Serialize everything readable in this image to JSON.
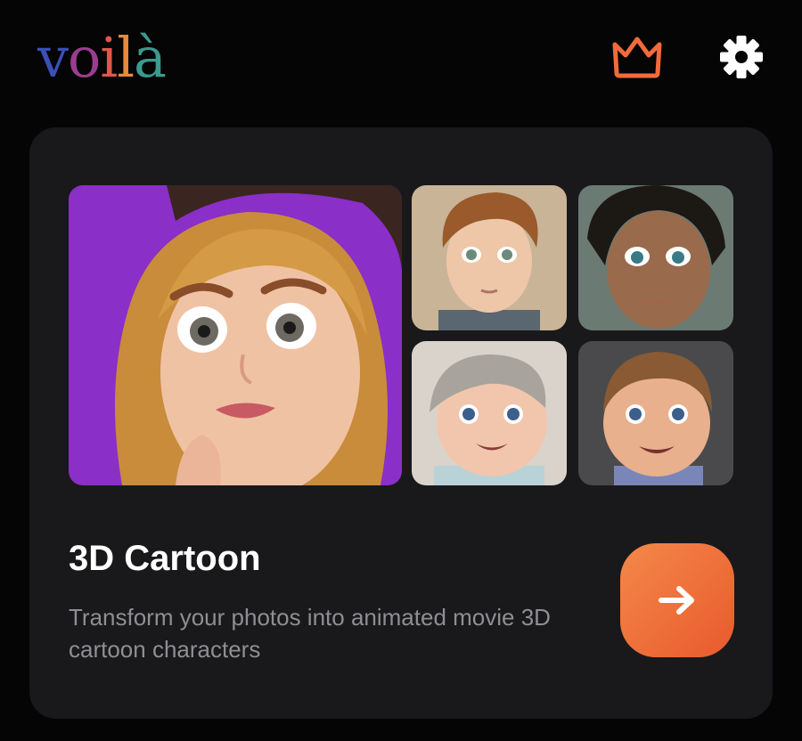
{
  "app": {
    "logo_letters": [
      {
        "char": "v",
        "color": "#3b4fb8"
      },
      {
        "char": "o",
        "color": "#9a3d8f"
      },
      {
        "char": "i",
        "color": "#e0574a"
      },
      {
        "char": "l",
        "color": "#e88a3a"
      },
      {
        "char": "à",
        "color": "#3a9b8e"
      }
    ]
  },
  "header": {
    "crown_icon": "crown-icon",
    "crown_color": "#f26b3a",
    "settings_icon": "gear-icon",
    "settings_color": "#ffffff"
  },
  "feature_card": {
    "title": "3D Cartoon",
    "description": "Transform your photos into animated movie 3D cartoon characters",
    "button_icon": "arrow-right-icon",
    "accent_color": "#ef6f3a",
    "preview_images": [
      {
        "name": "cartoon-woman-portrait",
        "background": "#8a2fc7"
      },
      {
        "name": "cartoon-boy-portrait",
        "background": "#c9b497"
      },
      {
        "name": "cartoon-girl-portrait",
        "background": "#6b7a72"
      },
      {
        "name": "cartoon-baby-portrait",
        "background": "#d9d3cc"
      },
      {
        "name": "cartoon-toddler-portrait",
        "background": "#4a4a4c"
      }
    ]
  }
}
